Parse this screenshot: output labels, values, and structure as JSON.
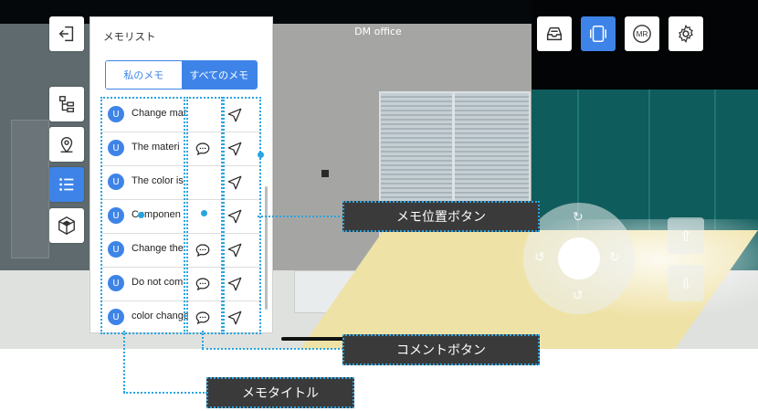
{
  "scene": {
    "title": "DM office"
  },
  "memo_panel": {
    "title": "メモリスト",
    "tabs": [
      {
        "label": "私のメモ",
        "selected": false
      },
      {
        "label": "すべてのメモ",
        "selected": true
      }
    ],
    "memos": [
      {
        "avatar": "U",
        "title": "Change mat",
        "has_comment": false
      },
      {
        "avatar": "U",
        "title": "The materi",
        "has_comment": true
      },
      {
        "avatar": "U",
        "title": "The color is",
        "has_comment": false
      },
      {
        "avatar": "U",
        "title": "Componen",
        "has_comment": false
      },
      {
        "avatar": "U",
        "title": "Change the",
        "has_comment": true
      },
      {
        "avatar": "U",
        "title": "Do not com",
        "has_comment": true
      },
      {
        "avatar": "U",
        "title": "color change",
        "has_comment": true
      }
    ]
  },
  "toolbar_top": {
    "buttons": [
      {
        "icon": "tray-icon",
        "active": false
      },
      {
        "icon": "device-frame-icon",
        "active": true
      },
      {
        "label": "MR",
        "active": false
      },
      {
        "icon": "gear-icon",
        "active": false
      }
    ]
  },
  "sidebar": {
    "exit_icon": "exit-icon",
    "items": [
      {
        "icon": "tree-icon",
        "active": false
      },
      {
        "icon": "map-pin-icon",
        "active": false
      },
      {
        "icon": "list-icon",
        "active": true
      },
      {
        "icon": "cube-icon",
        "active": false
      }
    ]
  },
  "annotations": {
    "memo_location_button": "メモ位置ボタン",
    "comment_button": "コメントボタン",
    "memo_title": "メモタイトル"
  },
  "colors": {
    "accent": "#3e84e8",
    "annotation": "#29a4e0",
    "callout_bg": "#3a3a3a"
  }
}
